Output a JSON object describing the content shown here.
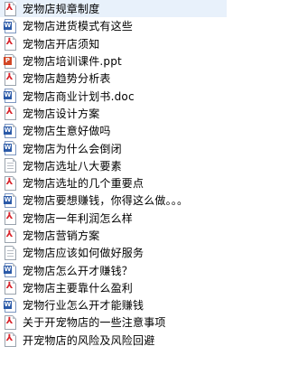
{
  "files": [
    {
      "name": "宠物店规章制度",
      "icon": "pdf-icon"
    },
    {
      "name": "宠物店进货模式有这些",
      "icon": "doc-icon"
    },
    {
      "name": "宠物店开店须知",
      "icon": "pdf-icon"
    },
    {
      "name": "宠物店培训课件.ppt",
      "icon": "ppt-icon"
    },
    {
      "name": "宠物店趋势分析表",
      "icon": "pdf-icon"
    },
    {
      "name": "宠物店商业计划书.doc",
      "icon": "doc-icon"
    },
    {
      "name": "宠物店设计方案",
      "icon": "pdf-icon"
    },
    {
      "name": "宠物店生意好做吗",
      "icon": "doc-icon"
    },
    {
      "name": "宠物店为什么会倒闭",
      "icon": "doc-icon"
    },
    {
      "name": "宠物店选址八大要素",
      "icon": "text-icon"
    },
    {
      "name": "宠物店选址的几个重要点",
      "icon": "pdf-icon"
    },
    {
      "name": "宠物店要想赚钱，你得这么做。。。",
      "icon": "doc-icon"
    },
    {
      "name": "宠物店一年利润怎么样",
      "icon": "pdf-icon"
    },
    {
      "name": "宠物店营销方案",
      "icon": "pdf-icon"
    },
    {
      "name": "宠物店应该如何做好服务",
      "icon": "text-icon"
    },
    {
      "name": "宠物店怎么开才赚钱？",
      "icon": "doc-icon"
    },
    {
      "name": "宠物店主要靠什么盈利",
      "icon": "pdf-icon"
    },
    {
      "name": "宠物行业怎么开才能赚钱",
      "icon": "doc-icon"
    },
    {
      "name": "关于开宠物店的一些注意事项",
      "icon": "pdf-icon"
    },
    {
      "name": "开宠物店的风险及风险回避",
      "icon": "pdf-icon"
    }
  ],
  "colors": {
    "pdf": "#d8232a",
    "doc": "#2b5aa8",
    "ppt": "#d24726",
    "text": "#000000"
  }
}
